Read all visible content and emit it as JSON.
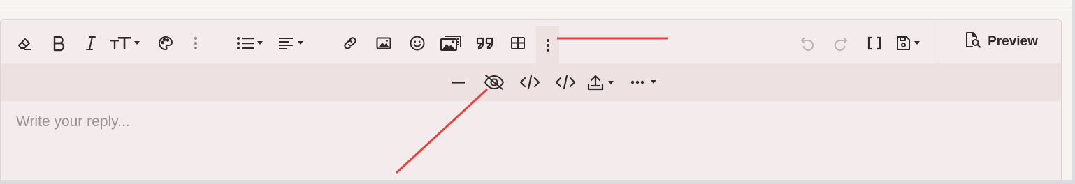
{
  "toolbar": {
    "row1_left": [
      {
        "icon": "eraser-icon",
        "name": "remove-format-button"
      },
      {
        "icon": "bold-icon",
        "name": "bold-button"
      },
      {
        "icon": "italic-icon",
        "name": "italic-button"
      },
      {
        "icon": "text-size-icon",
        "name": "text-size-button"
      },
      {
        "icon": "palette-icon",
        "name": "text-color-button"
      },
      {
        "icon": "vertical-dots-icon",
        "name": "more-text-button"
      },
      {
        "icon": "list-icon",
        "name": "list-button"
      },
      {
        "icon": "align-left-icon",
        "name": "align-button"
      },
      {
        "icon": "link-icon",
        "name": "insert-link-button"
      },
      {
        "icon": "image-icon",
        "name": "insert-image-button"
      },
      {
        "icon": "smile-icon",
        "name": "insert-smilie-button"
      },
      {
        "icon": "media-icon",
        "name": "insert-media-button"
      },
      {
        "icon": "quote-icon",
        "name": "insert-quote-button"
      },
      {
        "icon": "table-icon",
        "name": "insert-table-button"
      },
      {
        "icon": "vertical-dots-icon",
        "name": "more-insert-button"
      }
    ],
    "row1_right": [
      {
        "icon": "undo-icon",
        "name": "undo-button",
        "disabled": true
      },
      {
        "icon": "redo-icon",
        "name": "redo-button",
        "disabled": true
      },
      {
        "icon": "brackets-icon",
        "name": "toggle-bbcode-button"
      },
      {
        "icon": "save-drafts-icon",
        "name": "drafts-button"
      }
    ],
    "preview_label": "Preview",
    "row2": [
      {
        "icon": "horizontal-line-icon",
        "name": "insert-hr-button"
      },
      {
        "icon": "eye-slash-icon",
        "name": "spoiler-button"
      },
      {
        "icon": "code-icon",
        "name": "code-button"
      },
      {
        "icon": "inline-code-icon",
        "name": "inline-code-button"
      },
      {
        "icon": "upload-icon",
        "name": "attach-button"
      },
      {
        "icon": "more-horizontal-icon",
        "name": "more-options-button"
      }
    ]
  },
  "editor": {
    "placeholder": "Write your reply..."
  },
  "colors": {
    "editor_bg": "#f4ebec",
    "toolbar2_bg": "#ede1e2",
    "annotation_red": "#e8403a"
  }
}
